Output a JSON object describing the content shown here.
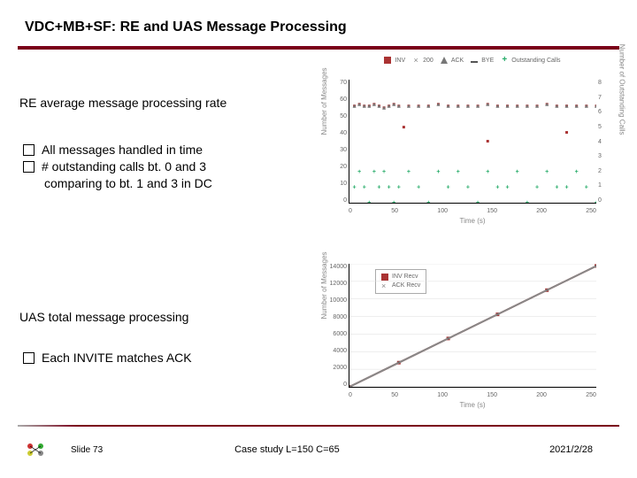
{
  "title": "VDC+MB+SF: RE and UAS Message Processing",
  "section_re_heading": "RE average message processing rate",
  "section_re_bullets": {
    "b1": "All messages handled in time",
    "b2": "# outstanding calls bt. 0 and 3",
    "b2_indent": "comparing to bt. 1 and 3 in DC"
  },
  "section_uas_heading": "UAS total message processing",
  "section_uas_bullets": {
    "b1": "Each INVITE matches ACK"
  },
  "footer": {
    "slide": "Slide 73",
    "case_study": "Case study L=150 C=65",
    "date": "2021/2/28"
  },
  "chart_data": [
    {
      "type": "scatter",
      "title": "RE average message processing rate",
      "xlabel": "Time (s)",
      "ylabel": "Number of Messages",
      "y2label": "Number of Outstanding Calls",
      "xlim": [
        0,
        250
      ],
      "ylim": [
        0,
        70
      ],
      "y2lim": [
        0,
        8
      ],
      "x_ticks": [
        0,
        50,
        100,
        150,
        200,
        250
      ],
      "y_ticks": [
        0,
        10,
        20,
        30,
        40,
        50,
        60,
        70
      ],
      "y2_ticks": [
        0,
        1,
        2,
        3,
        4,
        5,
        6,
        7,
        8
      ],
      "legend": [
        "INV",
        "200",
        "ACK",
        "BYE",
        "Outstanding Calls"
      ],
      "series": [
        {
          "name": "INV",
          "x": [
            5,
            10,
            15,
            20,
            25,
            30,
            35,
            40,
            45,
            50,
            60,
            70,
            80,
            90,
            100,
            110,
            120,
            130,
            140,
            150,
            160,
            170,
            180,
            190,
            200,
            210,
            220,
            230,
            240,
            250
          ],
          "values": [
            55,
            56,
            55,
            55,
            56,
            55,
            54,
            55,
            56,
            55,
            55,
            55,
            55,
            56,
            55,
            55,
            55,
            55,
            56,
            55,
            55,
            55,
            55,
            55,
            56,
            55,
            55,
            55,
            55,
            55
          ]
        },
        {
          "name": "200",
          "x": [
            5,
            10,
            15,
            20,
            25,
            30,
            35,
            40,
            45,
            50,
            60,
            70,
            80,
            90,
            100,
            110,
            120,
            130,
            140,
            150,
            160,
            170,
            180,
            190,
            200,
            210,
            220,
            230,
            240,
            250
          ],
          "values": [
            55,
            56,
            55,
            55,
            56,
            55,
            54,
            55,
            56,
            55,
            55,
            55,
            55,
            56,
            55,
            55,
            55,
            55,
            56,
            55,
            55,
            55,
            55,
            55,
            56,
            55,
            55,
            55,
            55,
            55
          ]
        },
        {
          "name": "ACK",
          "x": [
            5,
            10,
            15,
            20,
            25,
            30,
            35,
            40,
            45,
            50,
            60,
            70,
            80,
            90,
            100,
            110,
            120,
            130,
            140,
            150,
            160,
            170,
            180,
            190,
            200,
            210,
            220,
            230,
            240,
            250
          ],
          "values": [
            55,
            56,
            55,
            55,
            56,
            55,
            54,
            55,
            56,
            55,
            55,
            55,
            55,
            56,
            55,
            55,
            55,
            55,
            56,
            55,
            55,
            55,
            55,
            55,
            56,
            55,
            55,
            55,
            55,
            55
          ]
        },
        {
          "name": "BYE",
          "x": [
            5,
            10,
            15,
            20,
            25,
            30,
            35,
            40,
            45,
            50,
            60,
            70,
            80,
            90,
            100,
            110,
            120,
            130,
            140,
            150,
            160,
            170,
            180,
            190,
            200,
            210,
            220,
            230,
            240,
            250
          ],
          "values": [
            55,
            56,
            55,
            55,
            56,
            55,
            54,
            55,
            56,
            55,
            55,
            55,
            55,
            56,
            55,
            55,
            55,
            55,
            56,
            55,
            55,
            55,
            55,
            55,
            56,
            55,
            55,
            55,
            55,
            55
          ]
        },
        {
          "name": "Outstanding Calls",
          "axis": "y2",
          "x": [
            5,
            10,
            15,
            20,
            25,
            30,
            35,
            40,
            45,
            50,
            60,
            70,
            80,
            90,
            100,
            110,
            120,
            130,
            140,
            150,
            160,
            170,
            180,
            190,
            200,
            210,
            220,
            230,
            240,
            250
          ],
          "values": [
            1,
            2,
            1,
            0,
            2,
            1,
            2,
            1,
            0,
            1,
            2,
            1,
            0,
            2,
            1,
            2,
            1,
            0,
            2,
            1,
            1,
            2,
            0,
            1,
            2,
            1,
            1,
            2,
            1,
            0
          ]
        }
      ]
    },
    {
      "type": "line",
      "title": "UAS total message processing",
      "xlabel": "Time (s)",
      "ylabel": "Number of Messages",
      "xlim": [
        0,
        250
      ],
      "ylim": [
        0,
        14000
      ],
      "x_ticks": [
        0,
        50,
        100,
        150,
        200,
        250
      ],
      "y_ticks": [
        0,
        2000,
        4000,
        6000,
        8000,
        10000,
        12000,
        14000
      ],
      "legend": [
        "INV Recv",
        "ACK Recv"
      ],
      "series": [
        {
          "name": "INV Recv",
          "x": [
            0,
            50,
            100,
            150,
            200,
            250
          ],
          "values": [
            0,
            2750,
            5500,
            8250,
            11000,
            13750
          ]
        },
        {
          "name": "ACK Recv",
          "x": [
            0,
            50,
            100,
            150,
            200,
            250
          ],
          "values": [
            0,
            2750,
            5500,
            8250,
            11000,
            13750
          ]
        }
      ]
    }
  ]
}
